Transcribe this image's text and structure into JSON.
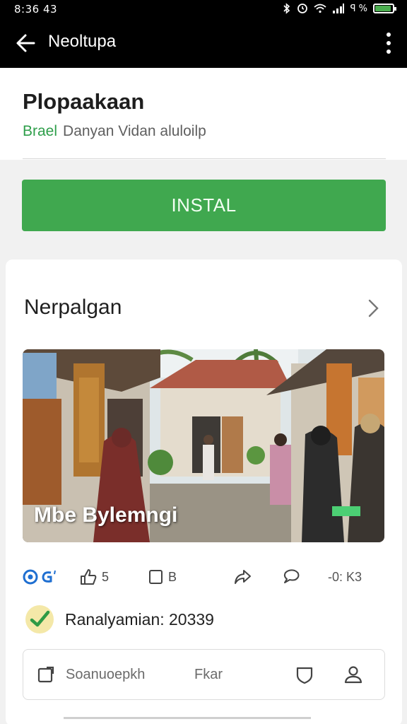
{
  "status": {
    "time": "8:36 43",
    "indicators": "ꟼ %",
    "icons": [
      "bluetooth-icon",
      "alarm-icon",
      "wifi-icon",
      "signal-icon",
      "battery-icon"
    ],
    "battery_level": 0.9
  },
  "appbar": {
    "title": "Neoltupa",
    "icons": [
      "back-arrow-icon",
      "more-vert-icon"
    ]
  },
  "app": {
    "name": "Plopaakaan",
    "developer_prefix": "Brael",
    "developer": "Danyan Vidan aluloilp"
  },
  "install": {
    "label": "INSTAL",
    "color": "#40a84f"
  },
  "section": {
    "title": "Nerpalgan",
    "photo_caption": "Mbe Bylemngi",
    "actions": [
      {
        "icon": "views-icon",
        "label": ""
      },
      {
        "icon": "thumb-up-icon",
        "label": "5"
      },
      {
        "icon": "comment-icon",
        "label": "B"
      },
      {
        "icon": "share-icon",
        "label": ""
      },
      {
        "icon": "reply-icon",
        "label": ""
      },
      {
        "icon": "more-count-icon",
        "label": "-0: K3"
      }
    ]
  },
  "verification": {
    "text": "Ranalyamian: 20339",
    "icon": "check-badge-icon"
  },
  "tools": {
    "left_label": "Soanuoepkh",
    "mid_label": "Fkar",
    "icons": [
      "edit-square-icon",
      "shield-icon",
      "person-icon"
    ]
  }
}
